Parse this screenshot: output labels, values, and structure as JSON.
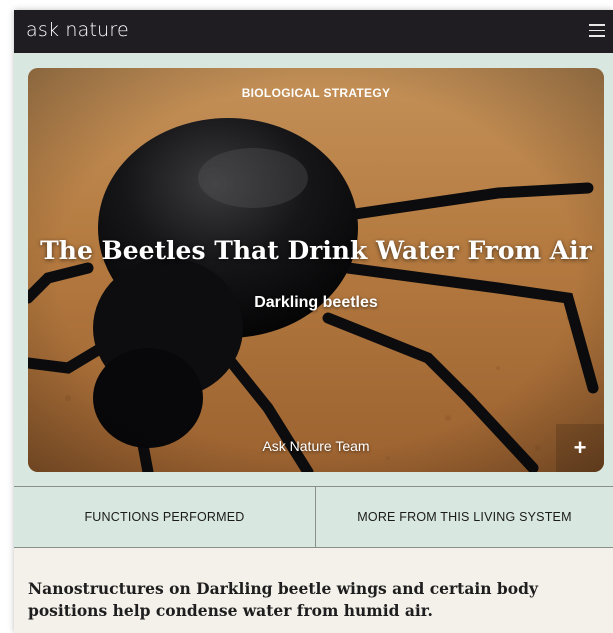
{
  "header": {
    "logo_text": "ask nature",
    "menu_icon": "hamburger-menu-icon"
  },
  "hero": {
    "eyebrow": "BIOLOGICAL STRATEGY",
    "title": "The Beetles That Drink Water From Air",
    "subtitle": "Darkling beetles",
    "author": "Ask Nature Team",
    "expand_label": "+",
    "image": "darkling-beetle-photo"
  },
  "tabs": [
    {
      "label": "FUNCTIONS PERFORMED"
    },
    {
      "label": "MORE FROM THIS LIVING SYSTEM"
    }
  ],
  "summary": {
    "text": "Nanostructures on Darkling beetle wings and certain body positions help condense water from humid air."
  },
  "colors": {
    "topbar": "#1f1d22",
    "hero_band": "#d8e7df",
    "page_background": "#f4f0ea",
    "text_dark": "#1e1e1e"
  }
}
